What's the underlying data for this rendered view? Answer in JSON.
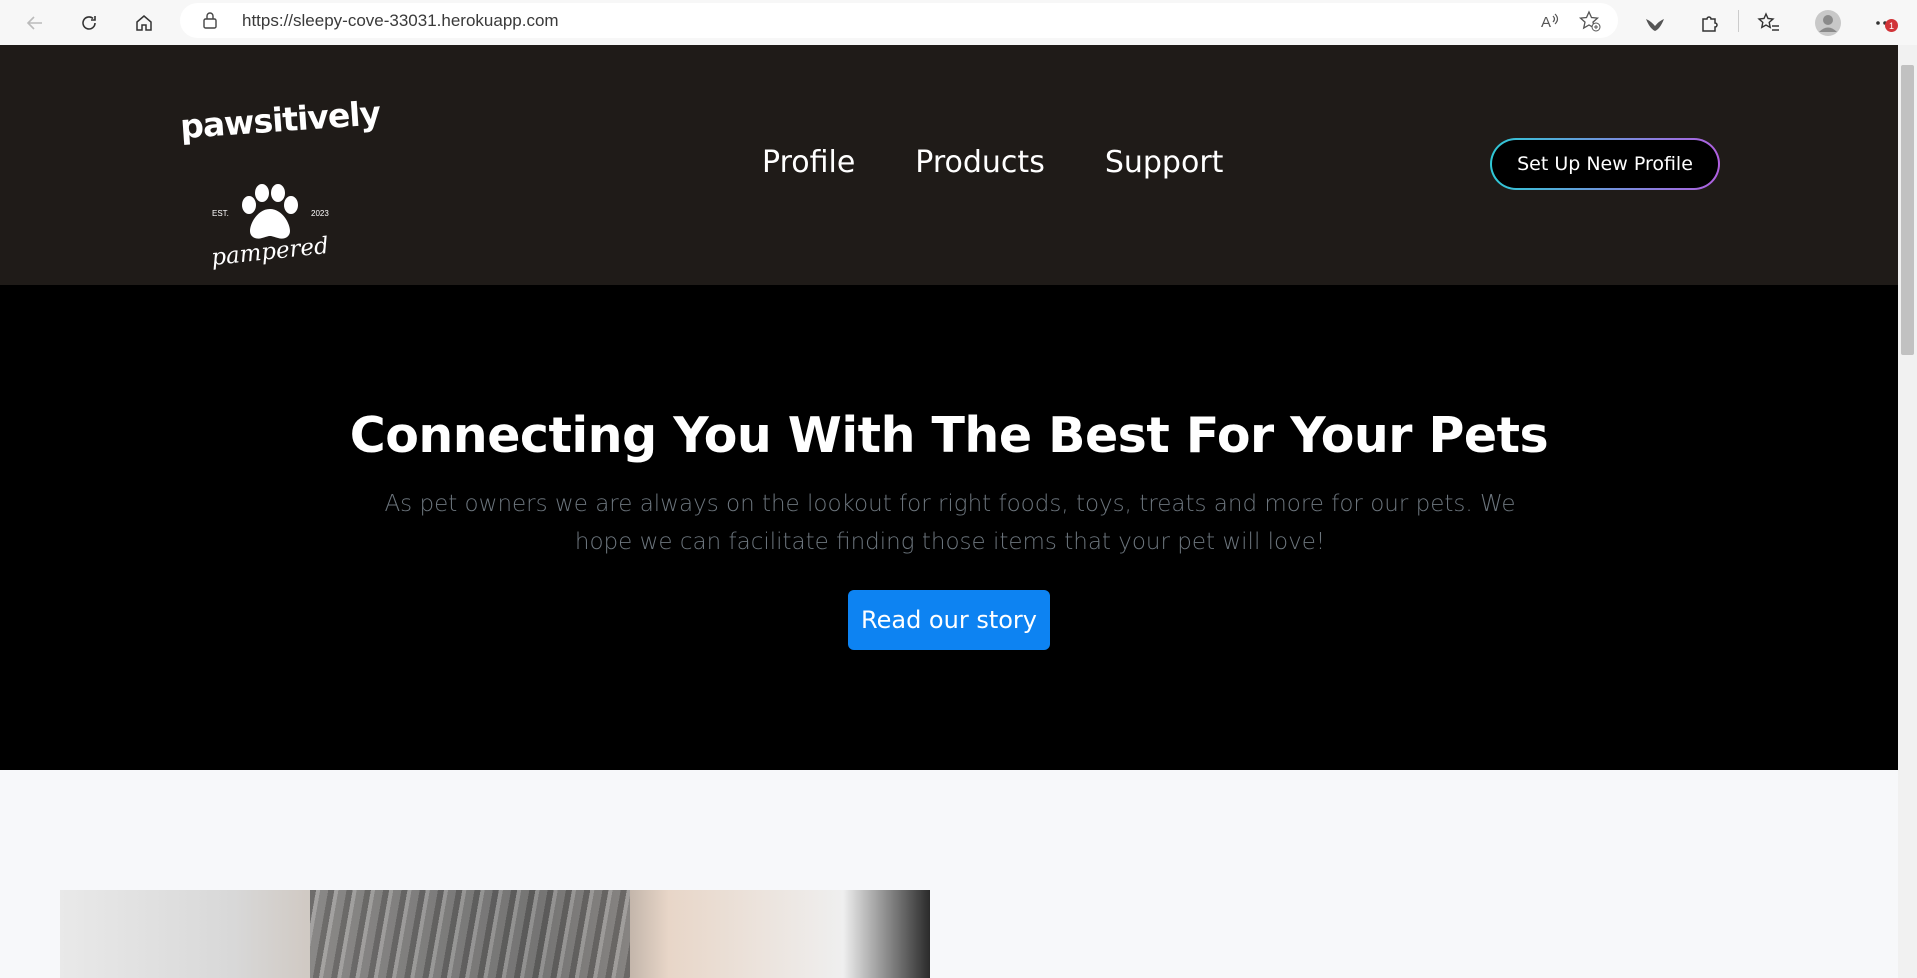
{
  "browser": {
    "url": "https://sleepy-cove-33031.herokuapp.com",
    "notification_count": "1",
    "icons": [
      "back-icon",
      "refresh-icon",
      "home-icon",
      "lock-icon",
      "read-aloud-icon",
      "favorite-add-icon",
      "extension-icon",
      "puzzle-icon",
      "favorites-icon",
      "profile-icon",
      "more-icon"
    ]
  },
  "header": {
    "logo": {
      "word_top": "pawsitively",
      "est": "EST.",
      "year": "2023",
      "word_bottom": "pampered"
    },
    "nav": [
      {
        "label": "Profile"
      },
      {
        "label": "Products"
      },
      {
        "label": "Support"
      }
    ],
    "cta_label": "Set Up New Profile"
  },
  "hero": {
    "title": "Connecting You With The Best For Your Pets",
    "subtitle": "As pet owners we are always on the lookout for right foods, toys, treats and more for our pets. We hope we can facilitate finding those items that your pet will love!",
    "button_label": "Read our story"
  },
  "colors": {
    "header_bg": "#1f1b18",
    "hero_bg": "#000000",
    "primary": "#0d83f2",
    "cta_gradient": [
      "#2ec9d6",
      "#b05fe0"
    ]
  }
}
